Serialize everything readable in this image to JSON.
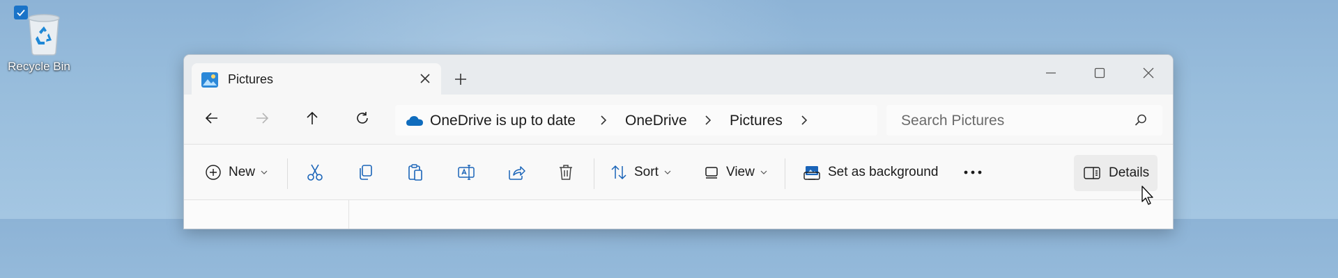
{
  "desktop": {
    "recycle_bin_label": "Recycle Bin",
    "recycle_bin_selected": true
  },
  "window": {
    "tab": {
      "title": "Pictures",
      "icon": "pictures-folder-icon"
    },
    "controls": [
      "minimize-icon",
      "maximize-icon",
      "close-icon"
    ]
  },
  "address_bar": {
    "sync_status": "OneDrive is up to date",
    "crumbs": [
      "OneDrive",
      "Pictures"
    ]
  },
  "search": {
    "placeholder": "Search Pictures"
  },
  "command_bar": {
    "new_label": "New",
    "sort_label": "Sort",
    "view_label": "View",
    "set_background_label": "Set as background",
    "details_label": "Details",
    "icon_buttons": [
      "cut-icon",
      "copy-icon",
      "paste-icon",
      "rename-icon",
      "share-icon",
      "delete-icon"
    ]
  },
  "colors": {
    "accent": "#1a73c8",
    "onedrive_blue": "#0f6cbd"
  }
}
